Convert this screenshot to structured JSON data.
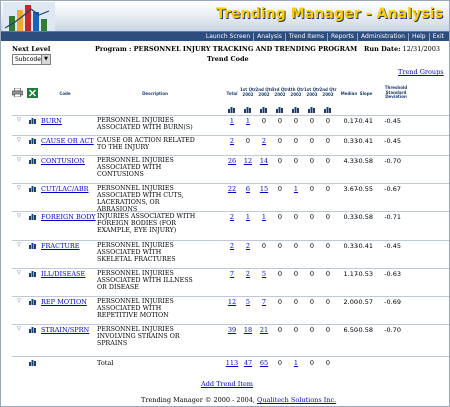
{
  "app": {
    "title": "Trending Manager - Analysis"
  },
  "nav": [
    "Launch Screen",
    "Analysis",
    "Trend Items",
    "Reports",
    "Administration",
    "Help",
    "Exit"
  ],
  "next_level": {
    "label": "Next Level",
    "selected": "Subcode"
  },
  "program": {
    "label": "Program :",
    "name": "PERSONNEL INJURY TRACKING AND TRENDING PROGRAM",
    "subtitle": "Trend Code"
  },
  "run_date": {
    "label": "Run Date:",
    "value": "12/31/2003"
  },
  "links": {
    "trend_groups": "Trend Groups",
    "add_trend_item": "Add Trend Item"
  },
  "table": {
    "headers": {
      "code": "Code",
      "description": "Description",
      "total": "Total",
      "q1": "1st Qtr 2002",
      "q2": "2nd Qtr 2002",
      "q3": "3rd Qtr 2002",
      "q4": "4th Qtr 2002",
      "q5": "1st Qtr 2003",
      "q6": "2nd Qtr 2003",
      "median": "Median",
      "slope": "Slope",
      "threshold": "Threshold Standard Deviation"
    },
    "rows": [
      {
        "code": "BURN",
        "description": "Personnel injuries associated with burn(s)",
        "total": "1",
        "q1": "1",
        "q2": "0",
        "q3": "0",
        "q4": "0",
        "q5": "0",
        "q6": "0",
        "median": "0.17",
        "slope": "-0.41",
        "threshold": "-0.45"
      },
      {
        "code": "CAUSE OR ACT",
        "description": "Cause or action related to the injury",
        "total": "2",
        "q1": "0",
        "q2": "2",
        "q3": "0",
        "q4": "0",
        "q5": "0",
        "q6": "0",
        "median": "0.33",
        "slope": "-0.41",
        "threshold": "-0.45"
      },
      {
        "code": "CONTUSION",
        "description": "Personnel injuries associated with contusions",
        "total": "26",
        "q1": "12",
        "q2": "14",
        "q3": "0",
        "q4": "0",
        "q5": "0",
        "q6": "0",
        "median": "4.33",
        "slope": "-0.58",
        "threshold": "-0.70"
      },
      {
        "code": "CUT/LAC/ABR",
        "description": "Personnel injuries associated with cuts, lacerations, or abrasions",
        "total": "22",
        "q1": "6",
        "q2": "15",
        "q3": "0",
        "q4": "1",
        "q5": "0",
        "q6": "0",
        "median": "3.67",
        "slope": "-0.55",
        "threshold": "-0.67"
      },
      {
        "code": "FOREIGN BODY",
        "description": "Injuries associated with foreign bodies (for example, eye injury)",
        "total": "2",
        "q1": "1",
        "q2": "1",
        "q3": "0",
        "q4": "0",
        "q5": "0",
        "q6": "0",
        "median": "0.33",
        "slope": "-0.58",
        "threshold": "-0.71"
      },
      {
        "code": "FRACTURE",
        "description": "Personnel injuries associated with skeletal fractures",
        "total": "2",
        "q1": "2",
        "q2": "0",
        "q3": "0",
        "q4": "0",
        "q5": "0",
        "q6": "0",
        "median": "0.33",
        "slope": "-0.41",
        "threshold": "-0.45"
      },
      {
        "code": "ILL/DISEASE",
        "description": "Personnel injuries associated with illness or disease",
        "total": "7",
        "q1": "2",
        "q2": "5",
        "q3": "0",
        "q4": "0",
        "q5": "0",
        "q6": "0",
        "median": "1.17",
        "slope": "-0.53",
        "threshold": "-0.63"
      },
      {
        "code": "REP MOTION",
        "description": "Personnel injuries associated with repetitive motion",
        "total": "12",
        "q1": "5",
        "q2": "7",
        "q3": "0",
        "q4": "0",
        "q5": "0",
        "q6": "0",
        "median": "2.00",
        "slope": "-0.57",
        "threshold": "-0.69"
      },
      {
        "code": "STRAIN/SPRN",
        "description": "Personnel injuries involving strains or sprains",
        "total": "39",
        "q1": "18",
        "q2": "21",
        "q3": "0",
        "q4": "0",
        "q5": "0",
        "q6": "0",
        "median": "6.50",
        "slope": "-0.58",
        "threshold": "-0.70"
      }
    ],
    "totals": {
      "label": "Total",
      "total": "113",
      "q1": "47",
      "q2": "65",
      "q3": "0",
      "q4": "1",
      "q5": "0",
      "q6": "0"
    }
  },
  "footer": {
    "text": "Trending Manager © 2000 - 2004,",
    "company": "Qualitech Solutions Inc."
  }
}
